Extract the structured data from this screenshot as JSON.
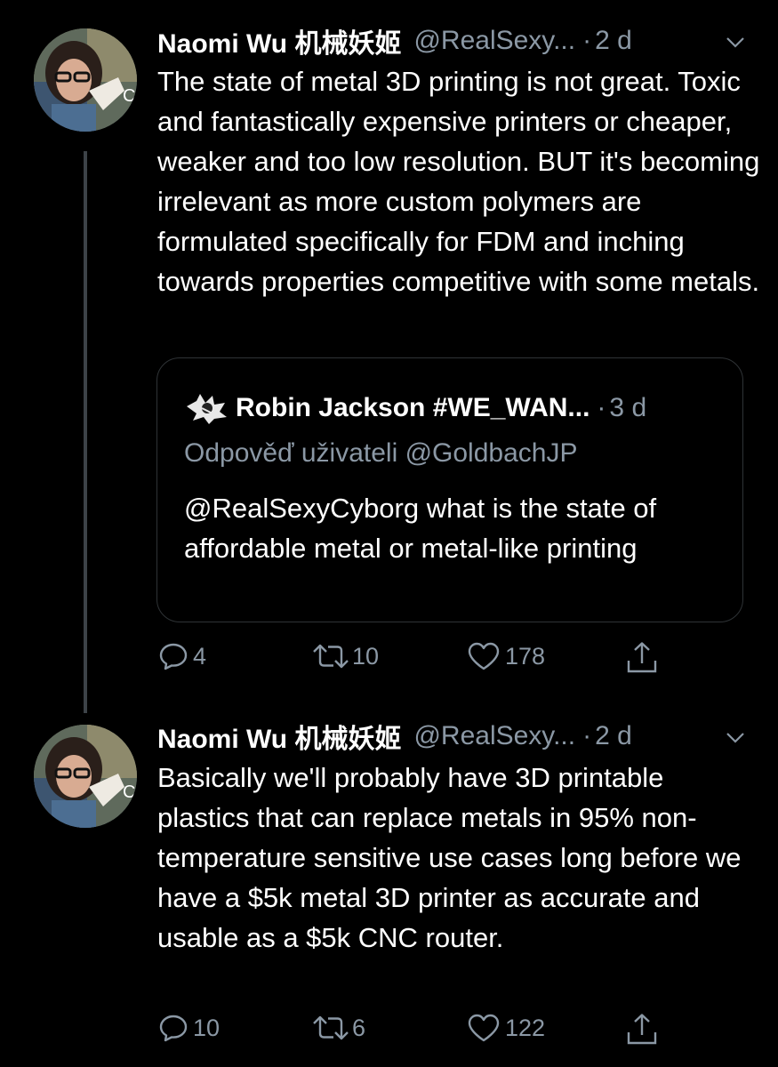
{
  "tweets": [
    {
      "author_name": "Naomi Wu 机械妖姬",
      "handle": "@RealSexy...",
      "time": "2 d",
      "text": "The state of metal 3D printing is not great. Toxic and fantastically expensive printers or cheaper, weaker and too low resolution. BUT it's becoming irrelevant as more custom polymers are formulated specifically for FDM and inching towards properties competitive with some metals.",
      "quote": {
        "author_name": "Robin Jackson #WE_WAN...",
        "time": "3 d",
        "reply_to": "Odpověď uživateli @GoldbachJP",
        "text": "@RealSexyCyborg what is the state of affordable metal or metal-like printing"
      },
      "replies": "4",
      "retweets": "10",
      "likes": "178"
    },
    {
      "author_name": "Naomi Wu 机械妖姬",
      "handle": "@RealSexy...",
      "time": "2 d",
      "text": "Basically we'll probably have 3D printable plastics that can replace metals in 95% non-temperature sensitive use cases long before we have a $5k metal 3D printer as accurate and usable as a $5k CNC router.",
      "replies": "10",
      "retweets": "6",
      "likes": "122"
    }
  ],
  "separator": "·",
  "colors": {
    "background": "#000000",
    "text": "#ffffff",
    "secondary": "#8b98a5",
    "border": "#2f3336",
    "thread_line": "#3d4348"
  },
  "icons": [
    "reply-icon",
    "retweet-icon",
    "like-icon",
    "share-icon",
    "chevron-down-icon"
  ]
}
